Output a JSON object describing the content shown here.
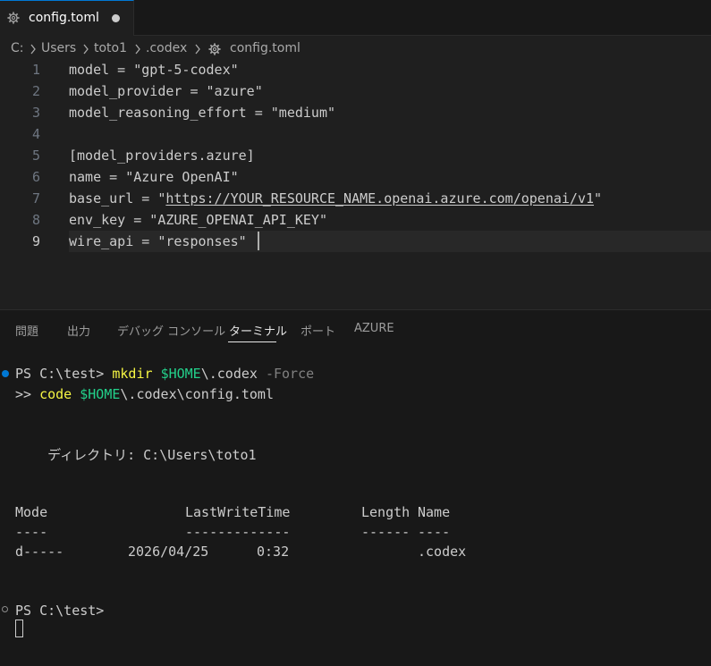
{
  "tab": {
    "label": "config.toml",
    "icon": "gear-icon",
    "unsaved": true,
    "accent": "#0078d4"
  },
  "breadcrumb": {
    "parts": [
      "C:",
      "Users",
      "toto1",
      ".codex",
      "config.toml"
    ]
  },
  "editor": {
    "current_line": 9,
    "lines": [
      {
        "n": "1",
        "code": "model = \"gpt-5-codex\""
      },
      {
        "n": "2",
        "code": "model_provider = \"azure\""
      },
      {
        "n": "3",
        "code": "model_reasoning_effort = \"medium\""
      },
      {
        "n": "4",
        "code": ""
      },
      {
        "n": "5",
        "code": "[model_providers.azure]"
      },
      {
        "n": "6",
        "code": "name = \"Azure OpenAI\""
      },
      {
        "n": "7",
        "code_pre": "base_url = \"",
        "code_url": "https://YOUR_RESOURCE_NAME.openai.azure.com/openai/v1",
        "code_post": "\""
      },
      {
        "n": "8",
        "code": "env_key = \"AZURE_OPENAI_API_KEY\""
      },
      {
        "n": "9",
        "code": "wire_api = \"responses\""
      }
    ]
  },
  "panel": {
    "tabs": [
      "問題",
      "出力",
      "デバッグ コンソール",
      "ターミナル",
      "ポート",
      "AZURE"
    ],
    "active_tab": "ターミナル"
  },
  "terminal": {
    "cmd1_prompt": "PS C:\\test> ",
    "cmd1_cmd": "mkdir",
    "cmd1_var": "$HOME",
    "cmd1_path": "\\.codex",
    "cmd1_flag": "-Force",
    "cmd2_prefix": ">> ",
    "cmd2_cmd": "code",
    "cmd2_var": "$HOME",
    "cmd2_path": "\\.codex\\config.toml",
    "dir_line": "    ディレクトリ: C:\\Users\\toto1",
    "header_mode": "Mode",
    "header_lwt": "LastWriteTime",
    "header_length": "Length",
    "header_name": "Name",
    "sep_mode": "----",
    "sep_lwt": "-------------",
    "sep_length": "------",
    "sep_name": "----",
    "row_mode": "d-----",
    "row_date": "2026/04/25",
    "row_time": "0:32",
    "row_name": ".codex",
    "prompt2": "PS C:\\test>"
  }
}
